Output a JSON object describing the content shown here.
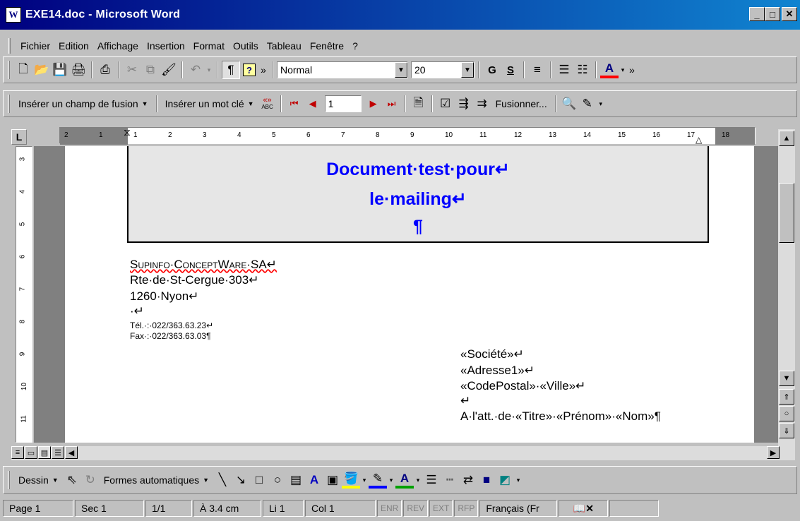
{
  "window": {
    "title": "EXE14.doc - Microsoft Word",
    "app_icon_glyph": "W",
    "minimize_glyph": "_",
    "maximize_glyph": "□",
    "close_glyph": "✕"
  },
  "menu": {
    "items": [
      "Fichier",
      "Edition",
      "Affichage",
      "Insertion",
      "Format",
      "Outils",
      "Tableau",
      "Fenêtre",
      "?"
    ]
  },
  "toolbar_standard": {
    "style_value": "Normal",
    "size_value": "20",
    "bold_label": "G",
    "underline_label": "S",
    "font_color_label": "A",
    "overflow_label": "»"
  },
  "toolbar_mailmerge": {
    "insert_field_label": "Insérer un champ de fusion",
    "insert_keyword_label": "Insérer un mot clé",
    "view_merged_label": "«»",
    "view_merged_sub": "ABC",
    "record_value": "1",
    "merge_label": "Fusionner..."
  },
  "ruler": {
    "corner_label": "L",
    "h_numbers": [
      "2",
      "1",
      "1",
      "2",
      "3",
      "4",
      "5",
      "6",
      "7",
      "8",
      "9",
      "10",
      "11",
      "12",
      "13",
      "14",
      "15",
      "16",
      "17",
      "18"
    ],
    "v_numbers": [
      "3",
      "4",
      "5",
      "6",
      "7",
      "8",
      "9",
      "10",
      "11"
    ]
  },
  "document": {
    "title_line1": "Document·test·pour↵",
    "title_line2": "le·mailing↵",
    "title_line3": "¶",
    "sender_company": "Supinfo·ConceptWare·SA↵",
    "sender_street": "Rte·de·St-Cergue·303↵",
    "sender_city": "1260·Nyon↵",
    "sender_blank": "·↵",
    "sender_tel": "Tél.·:·022/363.63.23↵",
    "sender_fax": "Fax·:·022/363.63.03¶",
    "recipient_company": "«Société»↵",
    "recipient_address": "«Adresse1»↵",
    "recipient_city": "«CodePostal»·«Ville»↵",
    "recipient_blank": "↵",
    "recipient_attention": "A·l'att.·de·«Titre»·«Prénom»·«Nom»¶"
  },
  "drawing_toolbar": {
    "draw_label": "Dessin",
    "autoshapes_label": "Formes automatiques",
    "font_color_label": "A"
  },
  "status": {
    "page": "Page 1",
    "section": "Sec 1",
    "pages": "1/1",
    "position": "À 3.4 cm",
    "line": "Li 1",
    "column": "Col 1",
    "enr": "ENR",
    "rev": "REV",
    "ext": "EXT",
    "rfp": "RFP",
    "language": "Français (Fr"
  },
  "colors": {
    "title_gradient_start": "#000080",
    "title_gradient_end": "#1084d0",
    "heading_text": "#0000ff",
    "chrome": "#c0c0c0"
  }
}
